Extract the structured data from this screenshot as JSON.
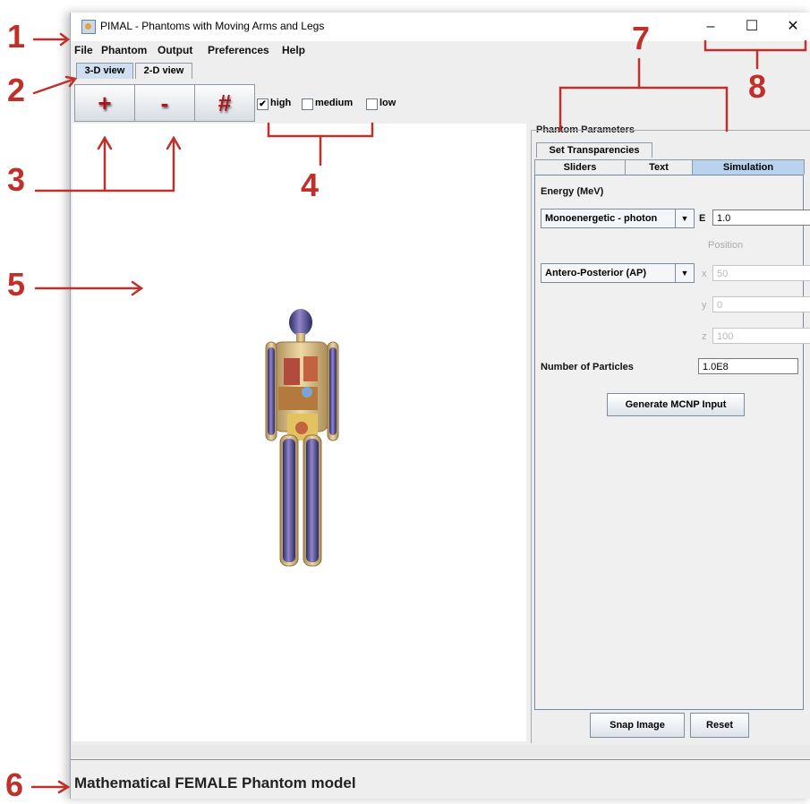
{
  "window": {
    "title": "PIMAL - Phantoms with Moving Arms and Legs",
    "controls": {
      "minimize": "–",
      "maximize": "☐",
      "close": "✕"
    }
  },
  "menu": [
    "File",
    "Phantom",
    "Output",
    "Preferences",
    "Help"
  ],
  "view_tabs": {
    "active": "3-D view",
    "items": [
      "3-D view",
      "2-D view"
    ]
  },
  "toolbar": {
    "zoom_in": "+",
    "zoom_out": "-",
    "grid": "#"
  },
  "quality": {
    "high": {
      "label": "high",
      "checked": true
    },
    "medium": {
      "label": "medium",
      "checked": false
    },
    "low": {
      "label": "low",
      "checked": false
    }
  },
  "params": {
    "title": "Phantom Parameters",
    "tab_transparencies": "Set Transparencies",
    "tabs": [
      "Sliders",
      "Text",
      "Simulation"
    ],
    "active_tab": "Simulation",
    "sim": {
      "energy_label": "Energy (MeV)",
      "energy_type": "Monoenergetic - photon",
      "e_label": "E",
      "e_value": "1.0",
      "position_label": "Position",
      "direction": "Antero-Posterior (AP)",
      "x_label": "x",
      "x_value": "50",
      "y_label": "y",
      "y_value": "0",
      "z_label": "z",
      "z_value": "100",
      "particles_label": "Number of Particles",
      "particles_value": "1.0E8",
      "generate_button": "Generate MCNP Input"
    },
    "snap_button": "Snap Image",
    "reset_button": "Reset"
  },
  "status": "Mathematical FEMALE Phantom model",
  "annotations": [
    "1",
    "2",
    "3",
    "4",
    "5",
    "6",
    "7",
    "8"
  ],
  "colors": {
    "annotation": "#c0302a",
    "selected_tab": "#b9d3ee",
    "panel_border": "#6f8baa"
  }
}
